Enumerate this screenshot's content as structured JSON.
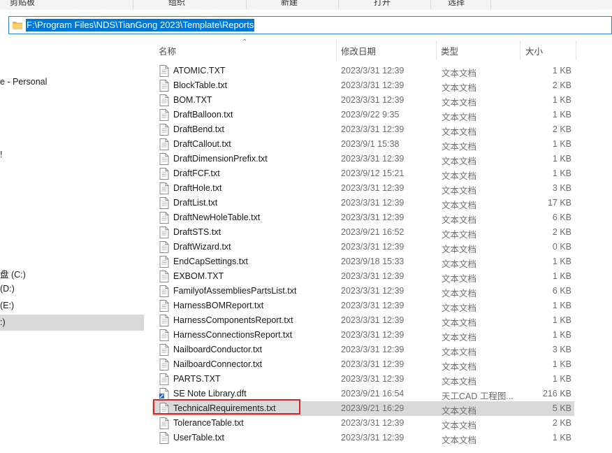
{
  "ribbon": {
    "groups": [
      "剪贴板",
      "组织",
      "新建",
      "打开",
      "选择"
    ]
  },
  "address": {
    "path": "F:\\Program Files\\NDS\\TianGong 2023\\Template\\Reports"
  },
  "nav": {
    "items": [
      "e - Personal",
      "!",
      "盘 (C:)",
      "(D:)",
      "(E:)",
      ":)"
    ]
  },
  "columns": {
    "name": "名称",
    "date": "修改日期",
    "type": "类型",
    "size": "大小"
  },
  "files": [
    {
      "name": "ATOMIC.TXT",
      "date": "2023/3/31 12:39",
      "type": "文本文档",
      "size": "1 KB",
      "icon": "text-file-icon"
    },
    {
      "name": "BlockTable.txt",
      "date": "2023/3/31 12:39",
      "type": "文本文档",
      "size": "2 KB",
      "icon": "text-file-icon"
    },
    {
      "name": "BOM.TXT",
      "date": "2023/3/31 12:39",
      "type": "文本文档",
      "size": "1 KB",
      "icon": "text-file-icon"
    },
    {
      "name": "DraftBalloon.txt",
      "date": "2023/9/22 9:35",
      "type": "文本文档",
      "size": "1 KB",
      "icon": "text-file-icon"
    },
    {
      "name": "DraftBend.txt",
      "date": "2023/3/31 12:39",
      "type": "文本文档",
      "size": "2 KB",
      "icon": "text-file-icon"
    },
    {
      "name": "DraftCallout.txt",
      "date": "2023/9/1 15:38",
      "type": "文本文档",
      "size": "1 KB",
      "icon": "text-file-icon"
    },
    {
      "name": "DraftDimensionPrefix.txt",
      "date": "2023/3/31 12:39",
      "type": "文本文档",
      "size": "1 KB",
      "icon": "text-file-icon"
    },
    {
      "name": "DraftFCF.txt",
      "date": "2023/9/12 15:21",
      "type": "文本文档",
      "size": "1 KB",
      "icon": "text-file-icon"
    },
    {
      "name": "DraftHole.txt",
      "date": "2023/3/31 12:39",
      "type": "文本文档",
      "size": "3 KB",
      "icon": "text-file-icon"
    },
    {
      "name": "DraftList.txt",
      "date": "2023/3/31 12:39",
      "type": "文本文档",
      "size": "17 KB",
      "icon": "text-file-icon"
    },
    {
      "name": "DraftNewHoleTable.txt",
      "date": "2023/3/31 12:39",
      "type": "文本文档",
      "size": "6 KB",
      "icon": "text-file-icon"
    },
    {
      "name": "DraftSTS.txt",
      "date": "2023/9/21 16:52",
      "type": "文本文档",
      "size": "2 KB",
      "icon": "text-file-icon"
    },
    {
      "name": "DraftWizard.txt",
      "date": "2023/3/31 12:39",
      "type": "文本文档",
      "size": "0 KB",
      "icon": "text-file-icon"
    },
    {
      "name": "EndCapSettings.txt",
      "date": "2023/9/18 15:33",
      "type": "文本文档",
      "size": "1 KB",
      "icon": "text-file-icon"
    },
    {
      "name": "EXBOM.TXT",
      "date": "2023/3/31 12:39",
      "type": "文本文档",
      "size": "1 KB",
      "icon": "text-file-icon"
    },
    {
      "name": "FamilyofAssembliesPartsList.txt",
      "date": "2023/3/31 12:39",
      "type": "文本文档",
      "size": "6 KB",
      "icon": "text-file-icon"
    },
    {
      "name": "HarnessBOMReport.txt",
      "date": "2023/3/31 12:39",
      "type": "文本文档",
      "size": "1 KB",
      "icon": "text-file-icon"
    },
    {
      "name": "HarnessComponentsReport.txt",
      "date": "2023/3/31 12:39",
      "type": "文本文档",
      "size": "1 KB",
      "icon": "text-file-icon"
    },
    {
      "name": "HarnessConnectionsReport.txt",
      "date": "2023/3/31 12:39",
      "type": "文本文档",
      "size": "1 KB",
      "icon": "text-file-icon"
    },
    {
      "name": "NailboardConductor.txt",
      "date": "2023/3/31 12:39",
      "type": "文本文档",
      "size": "3 KB",
      "icon": "text-file-icon"
    },
    {
      "name": "NailboardConnector.txt",
      "date": "2023/3/31 12:39",
      "type": "文本文档",
      "size": "1 KB",
      "icon": "text-file-icon"
    },
    {
      "name": "PARTS.TXT",
      "date": "2023/3/31 12:39",
      "type": "文本文档",
      "size": "1 KB",
      "icon": "text-file-icon"
    },
    {
      "name": "SE Note Library.dft",
      "date": "2023/9/21 16:54",
      "type": "天工CAD 工程图...",
      "size": "216 KB",
      "icon": "draft-file-icon"
    },
    {
      "name": "TechnicalRequirements.txt",
      "date": "2023/9/21 16:29",
      "type": "文本文档",
      "size": "5 KB",
      "icon": "text-file-icon",
      "highlighted": true
    },
    {
      "name": "ToleranceTable.txt",
      "date": "2023/3/31 12:39",
      "type": "文本文档",
      "size": "2 KB",
      "icon": "text-file-icon"
    },
    {
      "name": "UserTable.txt",
      "date": "2023/3/31 12:39",
      "type": "文本文档",
      "size": "1 KB",
      "icon": "text-file-icon"
    }
  ],
  "colors": {
    "selection": "#0078d7",
    "row_highlight": "#d9d9d9",
    "annotation_box": "#e02020"
  }
}
